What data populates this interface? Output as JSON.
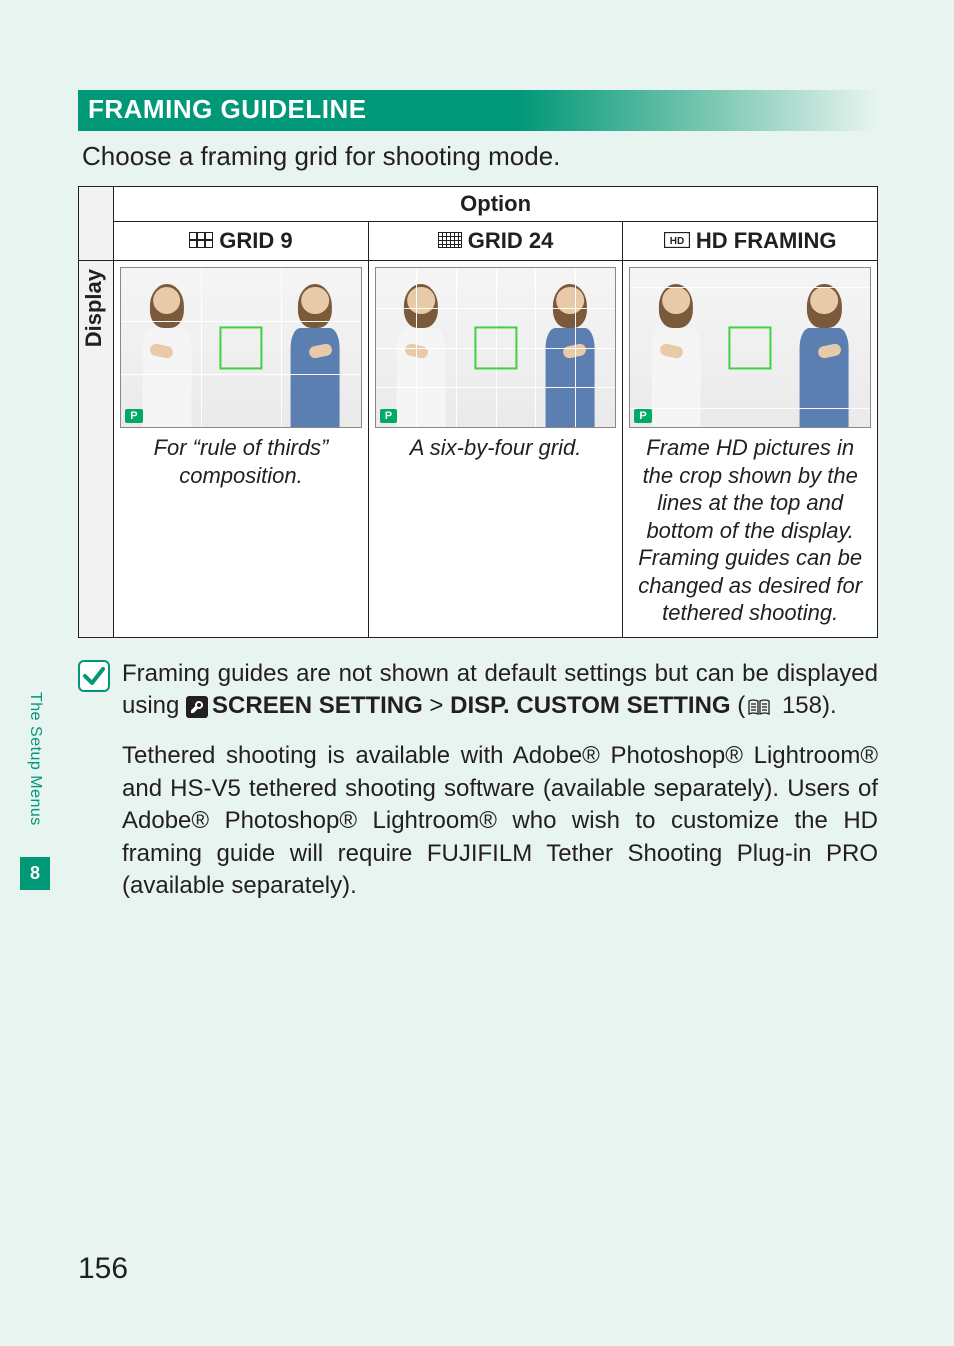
{
  "section_title": "FRAMING GUIDELINE",
  "intro": "Choose a framing grid for shooting mode.",
  "table": {
    "option_header": "Option",
    "display_header": "Display",
    "columns": [
      {
        "label": "GRID 9",
        "caption": "For “rule of thirds” composition."
      },
      {
        "label": "GRID 24",
        "caption": "A six-by-four grid."
      },
      {
        "label": "HD FRAMING",
        "caption": "Frame HD pictures in the crop shown by the lines at the top and bottom of the display. Framing guides can be changed as desired for tethered shooting."
      }
    ],
    "p_badge": "P"
  },
  "note": {
    "para1_pre": "Framing guides are not shown at default settings but can be displayed using ",
    "screen_setting": "SCREEN SETTING",
    "gt": " > ",
    "disp_custom": "DISP. CUSTOM SETTING",
    "para1_post_open": " (",
    "page_ref": " 158).",
    "para2": "Tethered shooting is available with Adobe® Photoshop® Lightroom® and HS-V5 tethered shooting software (available separately). Users of Adobe® Photoshop® Lightroom® who wish to customize the HD framing guide will require FUJIFILM Tether Shooting Plug-in PRO (available separately)."
  },
  "side": {
    "label": "The Setup Menus",
    "chapter": "8"
  },
  "page_number": "156"
}
